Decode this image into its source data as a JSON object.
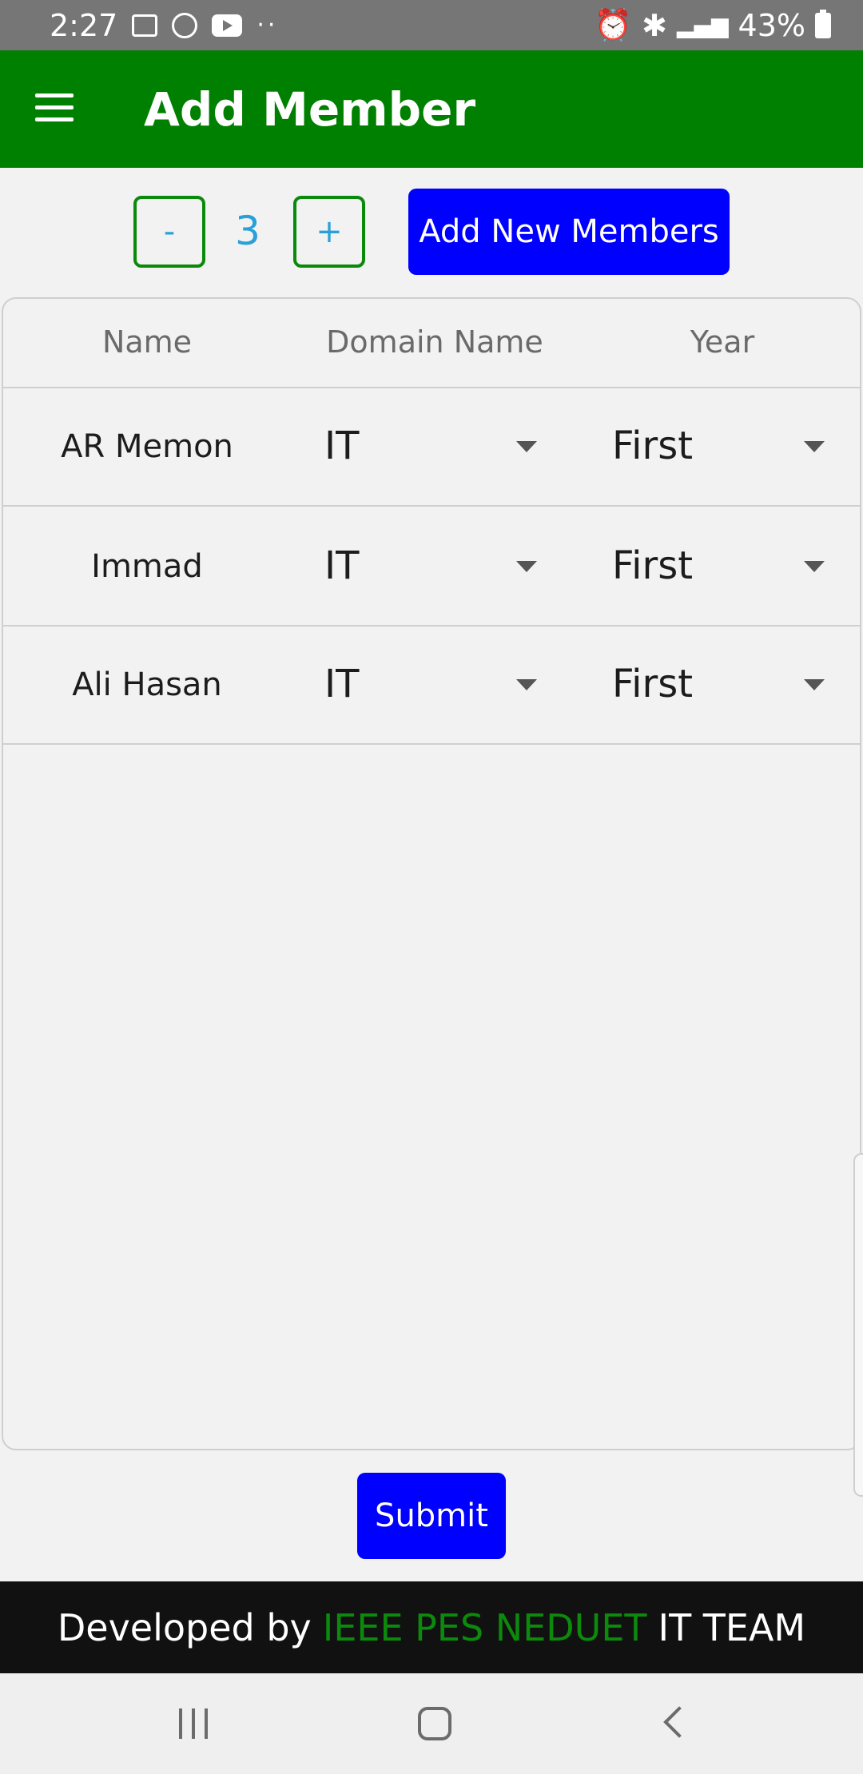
{
  "status_bar": {
    "time": "2:27",
    "left_icons": [
      "image-icon",
      "whatsapp-icon",
      "youtube-icon",
      "more-dots-icon"
    ],
    "right_icons": [
      "alarm-icon",
      "bluetooth-icon",
      "signal-icon",
      "battery-icon"
    ],
    "battery": "43%"
  },
  "app_bar": {
    "title": "Add Member",
    "menu_icon": "hamburger-menu-icon",
    "background": "#008000"
  },
  "controls": {
    "decrement_label": "-",
    "count": "3",
    "increment_label": "+",
    "add_button_label": "Add New Members",
    "button_color": "#0000ff"
  },
  "table": {
    "columns": [
      "Name",
      "Domain Name",
      "Year"
    ],
    "rows": [
      {
        "name": "AR Memon",
        "domain": "IT",
        "year": "First"
      },
      {
        "name": "Immad",
        "domain": "IT",
        "year": "First"
      },
      {
        "name": "Ali Hasan",
        "domain": "IT",
        "year": "First"
      }
    ]
  },
  "submit_label": "Submit",
  "footer": {
    "prefix": "Developed by",
    "accent": "IEEE PES NEDUET",
    "suffix": "IT TEAM",
    "accent_color": "#0c8a0c"
  },
  "nav_bar": {
    "icons": [
      "recent-apps-icon",
      "home-icon",
      "back-icon"
    ]
  }
}
